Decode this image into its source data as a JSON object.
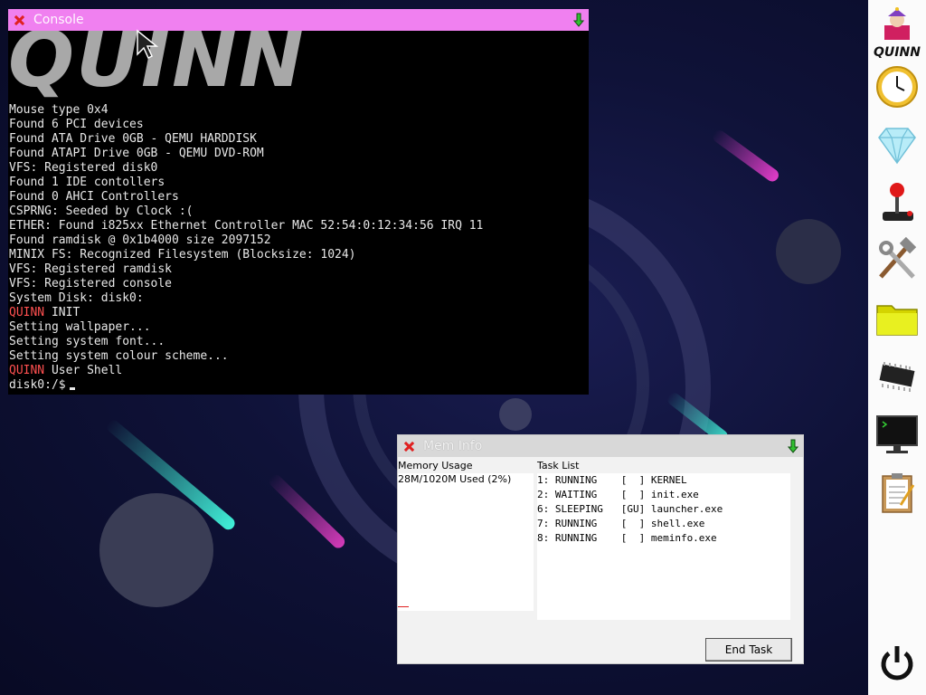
{
  "console": {
    "title": "Console",
    "logo_text": "QUINN",
    "lines": [
      {
        "prefix": "",
        "text": "Mouse type 0x4"
      },
      {
        "prefix": "",
        "text": "Found 6 PCI devices"
      },
      {
        "prefix": "",
        "text": "Found ATA Drive 0GB - QEMU HARDDISK"
      },
      {
        "prefix": "",
        "text": "Found ATAPI Drive 0GB - QEMU DVD-ROM"
      },
      {
        "prefix": "",
        "text": "VFS: Registered disk0"
      },
      {
        "prefix": "",
        "text": "Found 1 IDE contollers"
      },
      {
        "prefix": "",
        "text": "Found 0 AHCI Controllers"
      },
      {
        "prefix": "",
        "text": "CSPRNG: Seeded by Clock :("
      },
      {
        "prefix": "",
        "text": "ETHER: Found i825xx Ethernet Controller MAC 52:54:0:12:34:56 IRQ 11"
      },
      {
        "prefix": "",
        "text": "Found ramdisk @ 0x1b4000 size 2097152"
      },
      {
        "prefix": "",
        "text": "MINIX FS: Recognized Filesystem (Blocksize: 1024)"
      },
      {
        "prefix": "",
        "text": "VFS: Registered ramdisk"
      },
      {
        "prefix": "",
        "text": "VFS: Registered console"
      },
      {
        "prefix": "",
        "text": "System Disk: disk0:"
      },
      {
        "prefix": "QUINN",
        "text": " INIT"
      },
      {
        "prefix": "",
        "text": "Setting wallpaper..."
      },
      {
        "prefix": "",
        "text": "Setting system font..."
      },
      {
        "prefix": "",
        "text": "Setting system colour scheme..."
      },
      {
        "prefix": "QUINN",
        "text": " User Shell"
      }
    ],
    "prompt": "disk0:/$"
  },
  "meminfo": {
    "title": "Mem Info",
    "memory_usage_label": "Memory Usage",
    "memory_usage_value": "28M/1020M Used (2%)",
    "task_list_label": "Task List",
    "tasks": [
      "1: RUNNING    [  ] KERNEL",
      "2: WAITING    [  ] init.exe",
      "6: SLEEPING   [GU] launcher.exe",
      "7: RUNNING    [  ] shell.exe",
      "8: RUNNING    [  ] meminfo.exe"
    ],
    "end_task_label": "End Task"
  },
  "dock": {
    "items": [
      {
        "name": "quinn-launcher-icon",
        "label": "QUINN"
      },
      {
        "name": "clock-icon"
      },
      {
        "name": "diamond-icon"
      },
      {
        "name": "joystick-icon"
      },
      {
        "name": "tools-icon"
      },
      {
        "name": "folder-icon"
      },
      {
        "name": "chip-icon"
      },
      {
        "name": "terminal-icon"
      },
      {
        "name": "notepad-icon"
      },
      {
        "name": "power-icon"
      }
    ]
  },
  "colors": {
    "console_title_bg": "#f080f0",
    "meminfo_title_bg": "#d8d8d8",
    "accent_red": "#ff5050"
  }
}
